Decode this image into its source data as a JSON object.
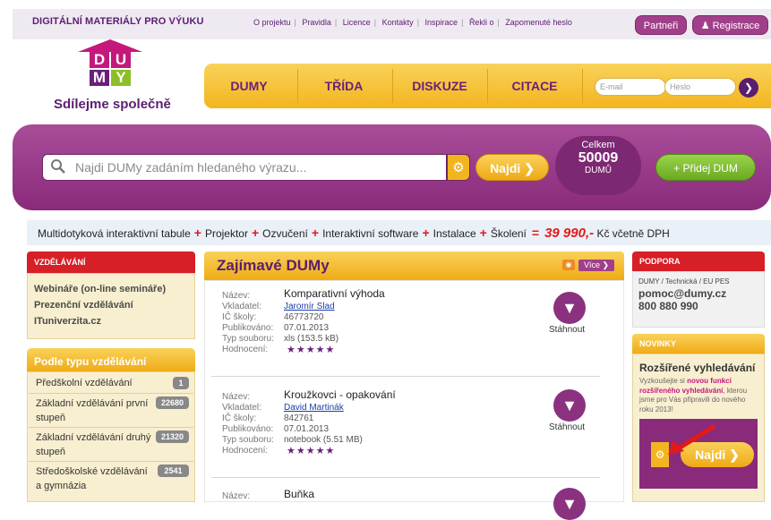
{
  "header": {
    "brand": "DIGITÁLNÍ MATERIÁLY PRO VÝUKU",
    "links": [
      "O projektu",
      "Pravidla",
      "Licence",
      "Kontakty",
      "Inspirace",
      "Řekli o",
      "Zapomenuté heslo"
    ],
    "partners_label": "Partneři",
    "register_label": "Registrace"
  },
  "logo": {
    "letters": [
      "D",
      "U",
      "M",
      "Y"
    ],
    "slogan": "Sdílejme společně"
  },
  "nav": {
    "items": [
      "DUMY",
      "TŘÍDA",
      "DISKUZE",
      "CITACE"
    ],
    "email_placeholder": "E-mail",
    "password_placeholder": "Heslo"
  },
  "search": {
    "placeholder": "Najdi DUMy zadáním hledaného výrazu...",
    "button_label": "Najdi",
    "counter_label": "Celkem",
    "counter_value": "50009",
    "counter_unit": "DUMŮ",
    "add_label": "+ Přidej DUM"
  },
  "promo": {
    "items": [
      "Multidotyková interaktivní tabule",
      "Projektor",
      "Ozvučení",
      "Interaktivní software",
      "Instalace",
      "Školení"
    ],
    "price": "39 990,-",
    "suffix": "Kč včetně DPH"
  },
  "left": {
    "vzdelavani_title": "VZDĚLÁVÁNÍ",
    "vzdelavani_links": [
      "Webináře (on-line semináře)",
      "Prezenční vzdělávání",
      "ITuniverzita.cz"
    ],
    "typ_title": "Podle typu vzdělávání",
    "typ_items": [
      {
        "label_lines": [
          "Předškolní vzdělávání"
        ],
        "count": "1"
      },
      {
        "label_lines": [
          "Základní vzdělávání první",
          "stupeň"
        ],
        "count": "22680"
      },
      {
        "label_lines": [
          "Základní vzdělávání druhý",
          "stupeň"
        ],
        "count": "21320"
      },
      {
        "label_lines": [
          "Středoškolské vzdělávání",
          "a gymnázia"
        ],
        "count": "2541"
      }
    ]
  },
  "center": {
    "title": "Zajímavé DUMy",
    "more_label": "Více",
    "labels": [
      "Název:",
      "Vkladatel:",
      "IČ školy:",
      "Publikováno:",
      "Typ souboru:",
      "Hodnocení:"
    ],
    "download_label": "Stáhnout",
    "items": [
      {
        "name": "Komparativní výhoda",
        "author": "Jaromír Slad",
        "ico": "46773720",
        "published": "07.01.2013",
        "filetype": "xls (153.5 kB)",
        "rating": "★★★★★"
      },
      {
        "name": "Kroužkovci - opakování",
        "author": "David Martinák",
        "ico": "842761",
        "published": "07.01.2013",
        "filetype": "notebook (5.51 MB)",
        "rating": "★★★★★"
      },
      {
        "name": "Buňka"
      }
    ]
  },
  "right": {
    "podpora_title": "PODPORA",
    "podpora_sub": "DUMY / Technická / EU PES",
    "email": "pomoc@dumy.cz",
    "phone": "800 880 990",
    "novinky_title": "NOVINKY",
    "novinky_heading": "Rozšířené vyhledávání",
    "novinky_text1": "Vyzkoušejte si ",
    "novinky_text_highlight": "novou funkci rozšířeného vyhledávání",
    "novinky_text2": ", kterou jsme pro Vás připravili do nového roku 2013!",
    "novinky_button": "Najdi"
  },
  "colors": {
    "purple": "#8a2a7b",
    "yellow": "#f3b51f",
    "red": "#d61f26",
    "green": "#6aaa21"
  }
}
